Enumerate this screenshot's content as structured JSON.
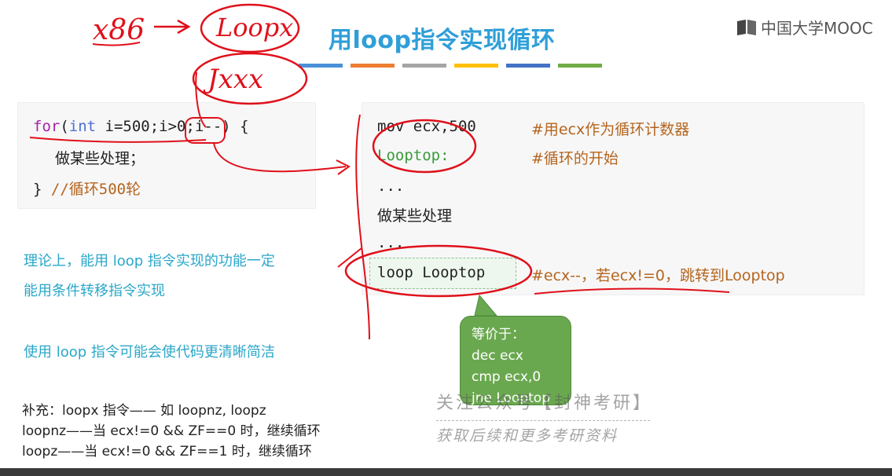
{
  "title": "用loop指令实现循环",
  "logo_text": "中国大学MOOC",
  "stripe_colors": [
    "#4a90d9",
    "#ed7d31",
    "#a5a5a5",
    "#ffc000",
    "#4472c4",
    "#70ad47"
  ],
  "c_code": {
    "line1": {
      "for": "for",
      "open": "(",
      "int": "int",
      "rest": " i=500;i>0;i--) {"
    },
    "line2": "做某些处理；",
    "line3": {
      "brace": "}",
      "comment": "//循环500轮"
    }
  },
  "asm_code": {
    "l1_code": "mov ecx,500",
    "l1_comment": "#用ecx作为循环计数器",
    "l2_label": "Looptop:",
    "l2_comment": "#循环的开始",
    "l3": "...",
    "l4": "做某些处理",
    "l5": "...",
    "l6_code": "loop Looptop",
    "l6_comment": "#ecx--，若ecx!=0，跳转到Looptop"
  },
  "body": {
    "p1_line1": "理论上，能用 loop 指令实现的功能一定",
    "p1_line2": "能用条件转移指令实现",
    "p2": "使用 loop 指令可能会使代码更清晰简洁"
  },
  "supplement": {
    "line1": "补充：loopx 指令—— 如 loopnz, loopz",
    "line2": "loopnz——当 ecx!=0 && ZF==0 时，继续循环",
    "line3": "loopz——当 ecx!=0 && ZF==1 时，继续循环"
  },
  "callout": {
    "line1": "等价于：",
    "line2": "dec ecx",
    "line3": "cmp ecx,0",
    "line4": "jne Looptop"
  },
  "watermark": {
    "line1": "关注公众号【封神考研】",
    "line2": "获取后续和更多考研资料"
  },
  "handwriting": {
    "x86": "x86",
    "loopx": "Loopx",
    "jxxx": "Jxxx"
  }
}
